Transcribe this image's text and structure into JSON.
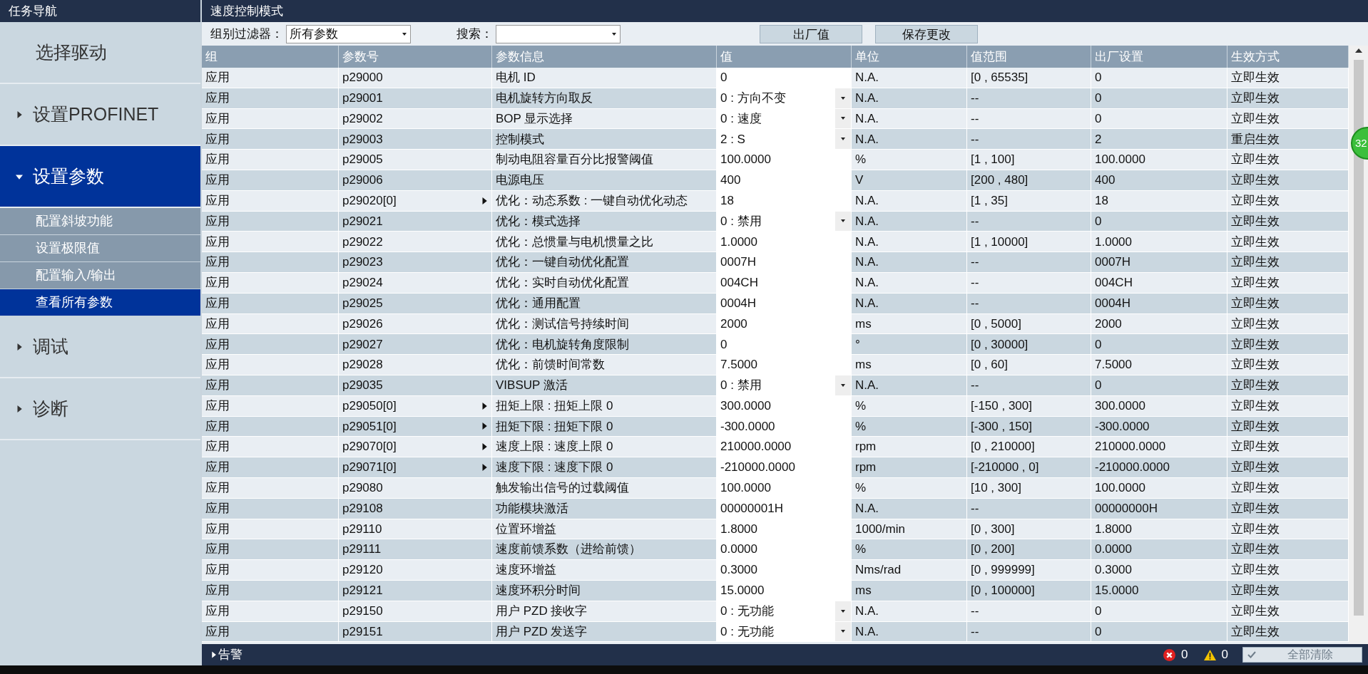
{
  "nav": {
    "title": "任务导航",
    "items": [
      {
        "label": "选择驱动",
        "selected": false
      },
      {
        "label": "设置PROFINET",
        "expanded": false,
        "selected": false
      },
      {
        "label": "设置参数",
        "expanded": true,
        "selected": true,
        "children": [
          {
            "label": "配置斜坡功能",
            "selected": false
          },
          {
            "label": "设置极限值",
            "selected": false
          },
          {
            "label": "配置输入/输出",
            "selected": false
          },
          {
            "label": "查看所有参数",
            "selected": true
          }
        ]
      },
      {
        "label": "调试",
        "expanded": false,
        "selected": false
      },
      {
        "label": "诊断",
        "expanded": false,
        "selected": false
      }
    ]
  },
  "panel": {
    "title": "速度控制模式",
    "filter": {
      "label": "组别过滤器：",
      "value": "所有参数"
    },
    "search": {
      "label": "搜索："
    },
    "buttons": [
      "出厂值",
      "保存更改"
    ],
    "table": {
      "columns": [
        "组",
        "参数号",
        "参数信息",
        "值",
        "单位",
        "值范围",
        "出厂设置",
        "生效方式"
      ],
      "rows": [
        {
          "group": "应用",
          "param": "p29000",
          "expandable": false,
          "info": "电机 ID",
          "value": "0",
          "kind": "text",
          "unit": "N.A.",
          "range": "[0 , 65535]",
          "factory": "0",
          "effect": "立即生效"
        },
        {
          "group": "应用",
          "param": "p29001",
          "expandable": false,
          "info": "电机旋转方向取反",
          "value": "0 : 方向不变",
          "kind": "dropdown",
          "unit": "N.A.",
          "range": "--",
          "factory": "0",
          "effect": "立即生效"
        },
        {
          "group": "应用",
          "param": "p29002",
          "expandable": false,
          "info": "BOP 显示选择",
          "value": "0 : 速度",
          "kind": "dropdown",
          "unit": "N.A.",
          "range": "--",
          "factory": "0",
          "effect": "立即生效"
        },
        {
          "group": "应用",
          "param": "p29003",
          "expandable": false,
          "info": "控制模式",
          "value": "2 : S",
          "kind": "dropdown",
          "unit": "N.A.",
          "range": "--",
          "factory": "2",
          "effect": "重启生效"
        },
        {
          "group": "应用",
          "param": "p29005",
          "expandable": false,
          "info": "制动电阻容量百分比报警阈值",
          "value": "100.0000",
          "kind": "text",
          "unit": "%",
          "range": "[1 , 100]",
          "factory": "100.0000",
          "effect": "立即生效"
        },
        {
          "group": "应用",
          "param": "p29006",
          "expandable": false,
          "info": "电源电压",
          "value": "400",
          "kind": "text",
          "unit": "V",
          "range": "[200 , 480]",
          "factory": "400",
          "effect": "立即生效"
        },
        {
          "group": "应用",
          "param": "p29020[0]",
          "expandable": true,
          "info": "优化：动态系数 : 一键自动优化动态",
          "value": "18",
          "kind": "text",
          "unit": "N.A.",
          "range": "[1 , 35]",
          "factory": "18",
          "effect": "立即生效"
        },
        {
          "group": "应用",
          "param": "p29021",
          "expandable": false,
          "info": "优化：模式选择",
          "value": "0 : 禁用",
          "kind": "dropdown",
          "unit": "N.A.",
          "range": "--",
          "factory": "0",
          "effect": "立即生效"
        },
        {
          "group": "应用",
          "param": "p29022",
          "expandable": false,
          "info": "优化：总惯量与电机惯量之比",
          "value": "1.0000",
          "kind": "text",
          "unit": "N.A.",
          "range": "[1 , 10000]",
          "factory": "1.0000",
          "effect": "立即生效"
        },
        {
          "group": "应用",
          "param": "p29023",
          "expandable": false,
          "info": "优化：一键自动优化配置",
          "value": "0007H",
          "kind": "text",
          "unit": "N.A.",
          "range": "--",
          "factory": "0007H",
          "effect": "立即生效"
        },
        {
          "group": "应用",
          "param": "p29024",
          "expandable": false,
          "info": "优化：实时自动优化配置",
          "value": "004CH",
          "kind": "text",
          "unit": "N.A.",
          "range": "--",
          "factory": "004CH",
          "effect": "立即生效"
        },
        {
          "group": "应用",
          "param": "p29025",
          "expandable": false,
          "info": "优化：通用配置",
          "value": "0004H",
          "kind": "text",
          "unit": "N.A.",
          "range": "--",
          "factory": "0004H",
          "effect": "立即生效"
        },
        {
          "group": "应用",
          "param": "p29026",
          "expandable": false,
          "info": "优化：测试信号持续时间",
          "value": "2000",
          "kind": "text",
          "unit": "ms",
          "range": "[0 , 5000]",
          "factory": "2000",
          "effect": "立即生效"
        },
        {
          "group": "应用",
          "param": "p29027",
          "expandable": false,
          "info": "优化：电机旋转角度限制",
          "value": "0",
          "kind": "text",
          "unit": "°",
          "range": "[0 , 30000]",
          "factory": "0",
          "effect": "立即生效"
        },
        {
          "group": "应用",
          "param": "p29028",
          "expandable": false,
          "info": "优化：前馈时间常数",
          "value": "7.5000",
          "kind": "text",
          "unit": "ms",
          "range": "[0 , 60]",
          "factory": "7.5000",
          "effect": "立即生效"
        },
        {
          "group": "应用",
          "param": "p29035",
          "expandable": false,
          "info": "VIBSUP 激活",
          "value": "0 : 禁用",
          "kind": "dropdown",
          "unit": "N.A.",
          "range": "--",
          "factory": "0",
          "effect": "立即生效"
        },
        {
          "group": "应用",
          "param": "p29050[0]",
          "expandable": true,
          "info": "扭矩上限 : 扭矩上限 0",
          "value": "300.0000",
          "kind": "text",
          "unit": "%",
          "range": "[-150 , 300]",
          "factory": "300.0000",
          "effect": "立即生效"
        },
        {
          "group": "应用",
          "param": "p29051[0]",
          "expandable": true,
          "info": "扭矩下限 : 扭矩下限 0",
          "value": "-300.0000",
          "kind": "text",
          "unit": "%",
          "range": "[-300 , 150]",
          "factory": "-300.0000",
          "effect": "立即生效"
        },
        {
          "group": "应用",
          "param": "p29070[0]",
          "expandable": true,
          "info": "速度上限 : 速度上限 0",
          "value": "210000.0000",
          "kind": "text",
          "unit": "rpm",
          "range": "[0 , 210000]",
          "factory": "210000.0000",
          "effect": "立即生效"
        },
        {
          "group": "应用",
          "param": "p29071[0]",
          "expandable": true,
          "info": "速度下限 : 速度下限 0",
          "value": "-210000.0000",
          "kind": "text",
          "unit": "rpm",
          "range": "[-210000 , 0]",
          "factory": "-210000.0000",
          "effect": "立即生效"
        },
        {
          "group": "应用",
          "param": "p29080",
          "expandable": false,
          "info": "触发输出信号的过载阈值",
          "value": "100.0000",
          "kind": "text",
          "unit": "%",
          "range": "[10 , 300]",
          "factory": "100.0000",
          "effect": "立即生效"
        },
        {
          "group": "应用",
          "param": "p29108",
          "expandable": false,
          "info": "功能模块激活",
          "value": "00000001H",
          "kind": "text",
          "unit": "N.A.",
          "range": "--",
          "factory": "00000000H",
          "effect": "立即生效"
        },
        {
          "group": "应用",
          "param": "p29110",
          "expandable": false,
          "info": "位置环增益",
          "value": "1.8000",
          "kind": "text",
          "unit": "1000/min",
          "range": "[0 , 300]",
          "factory": "1.8000",
          "effect": "立即生效"
        },
        {
          "group": "应用",
          "param": "p29111",
          "expandable": false,
          "info": "速度前馈系数（进给前馈）",
          "value": "0.0000",
          "kind": "text",
          "unit": "%",
          "range": "[0 , 200]",
          "factory": "0.0000",
          "effect": "立即生效"
        },
        {
          "group": "应用",
          "param": "p29120",
          "expandable": false,
          "info": "速度环增益",
          "value": "0.3000",
          "kind": "text",
          "unit": "Nms/rad",
          "range": "[0 , 999999]",
          "factory": "0.3000",
          "effect": "立即生效"
        },
        {
          "group": "应用",
          "param": "p29121",
          "expandable": false,
          "info": "速度环积分时间",
          "value": "15.0000",
          "kind": "text",
          "unit": "ms",
          "range": "[0 , 100000]",
          "factory": "15.0000",
          "effect": "立即生效"
        },
        {
          "group": "应用",
          "param": "p29150",
          "expandable": false,
          "info": "用户 PZD 接收字",
          "value": "0 : 无功能",
          "kind": "dropdown",
          "unit": "N.A.",
          "range": "--",
          "factory": "0",
          "effect": "立即生效"
        },
        {
          "group": "应用",
          "param": "p29151",
          "expandable": false,
          "info": "用户 PZD 发送字",
          "value": "0 : 无功能",
          "kind": "dropdown",
          "unit": "N.A.",
          "range": "--",
          "factory": "0",
          "effect": "立即生效"
        }
      ]
    }
  },
  "alarms": {
    "label": "告警",
    "expanded": false,
    "errors": "0",
    "warnings": "0",
    "clear_button": {
      "label": "全部清除",
      "disabled": true
    }
  },
  "badge": "32"
}
